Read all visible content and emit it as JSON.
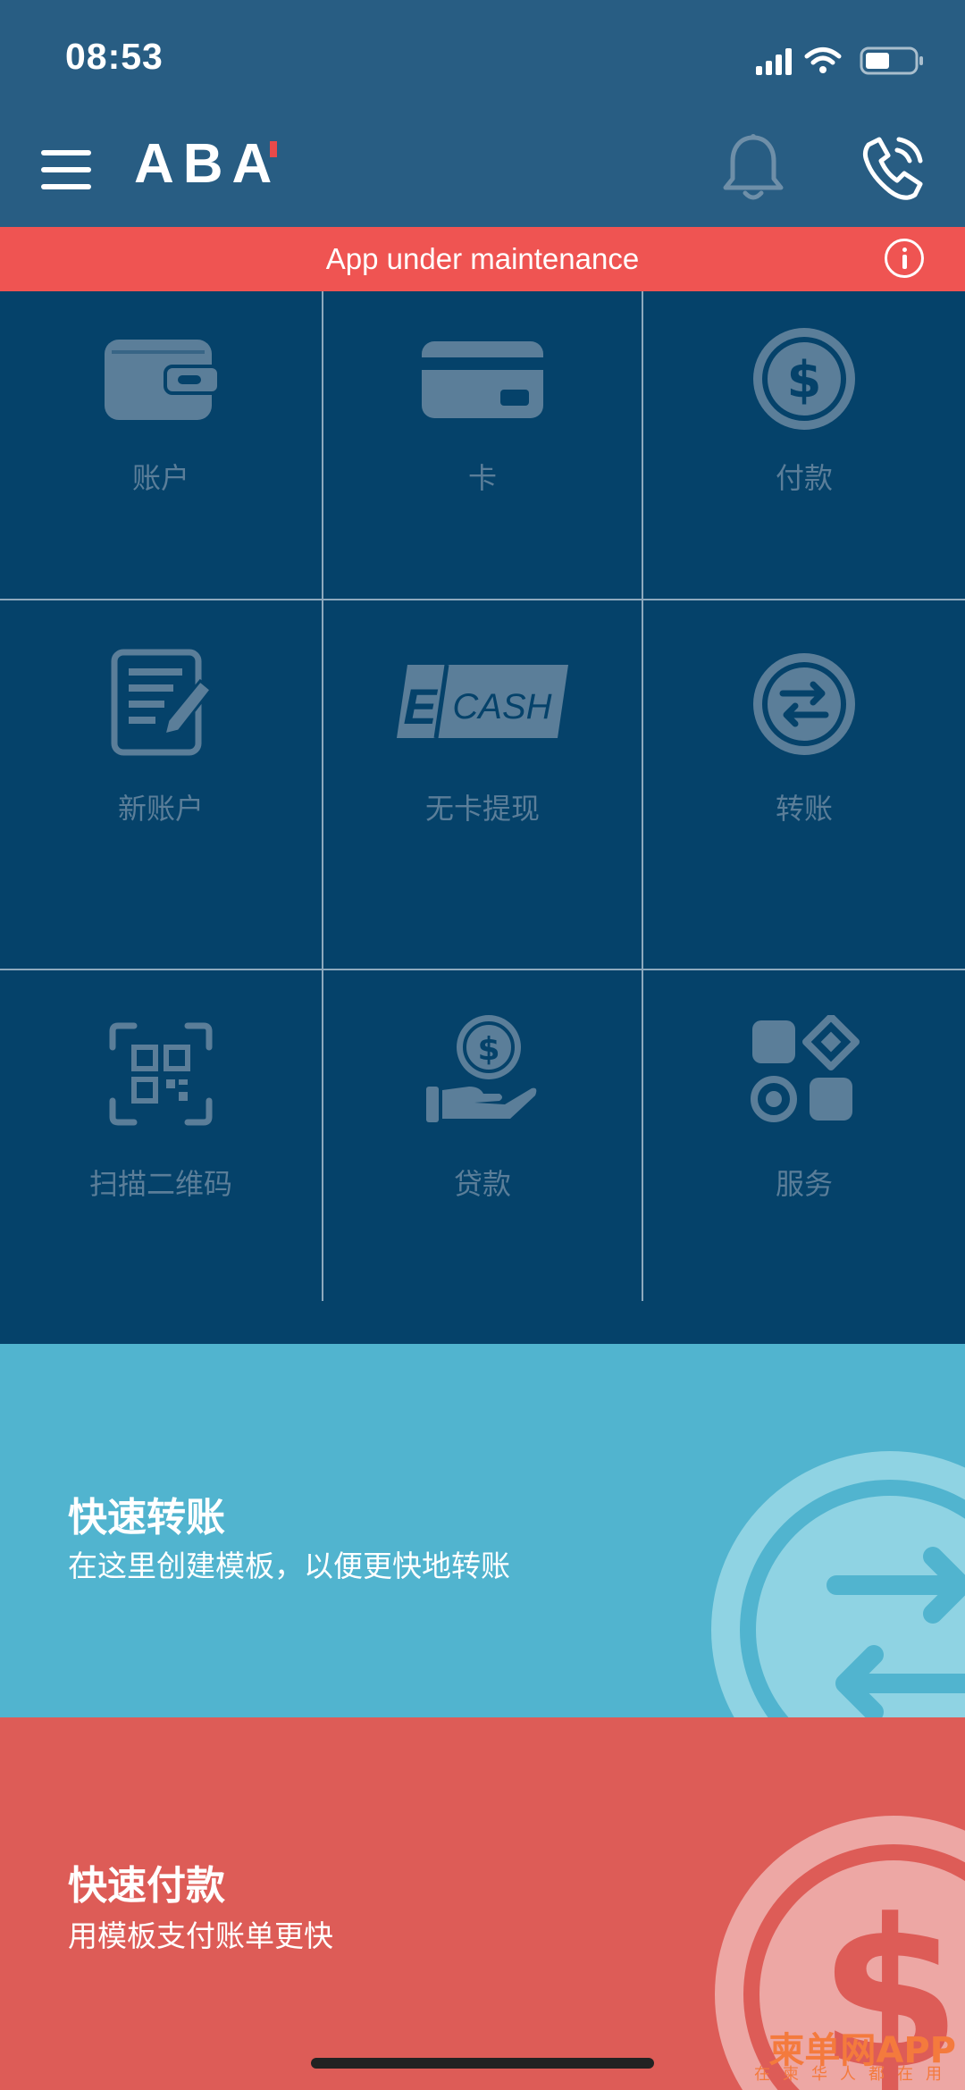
{
  "status_bar": {
    "time": "08:53"
  },
  "header": {
    "logo": "ABA"
  },
  "banner": {
    "text": "App under maintenance"
  },
  "grid": {
    "items": [
      {
        "label": "账户",
        "icon": "wallet-icon"
      },
      {
        "label": "卡",
        "icon": "card-icon"
      },
      {
        "label": "付款",
        "icon": "dollar-coin-icon"
      },
      {
        "label": "新账户",
        "icon": "document-pen-icon"
      },
      {
        "label": "无卡提现",
        "icon": "ecash-icon",
        "icon_text": "CASH",
        "icon_letter": "E"
      },
      {
        "label": "转账",
        "icon": "transfer-arrows-icon"
      },
      {
        "label": "扫描二维码",
        "icon": "qr-scan-icon"
      },
      {
        "label": "贷款",
        "icon": "loan-hand-icon"
      },
      {
        "label": "服务",
        "icon": "services-icon"
      }
    ]
  },
  "quick_transfer": {
    "title": "快速转账",
    "subtitle": "在这里创建模板，以便更快地转账"
  },
  "quick_pay": {
    "title": "快速付款",
    "subtitle": "用模板支付账单更快"
  },
  "watermark": {
    "text": "柬单网APP",
    "sub": "在柬华人都在用"
  },
  "colors": {
    "header": "#285d83",
    "banner": "#ef5452",
    "grid": "#05426a",
    "transfer_card": "#51b4cf",
    "pay_card": "#dd5c57"
  }
}
